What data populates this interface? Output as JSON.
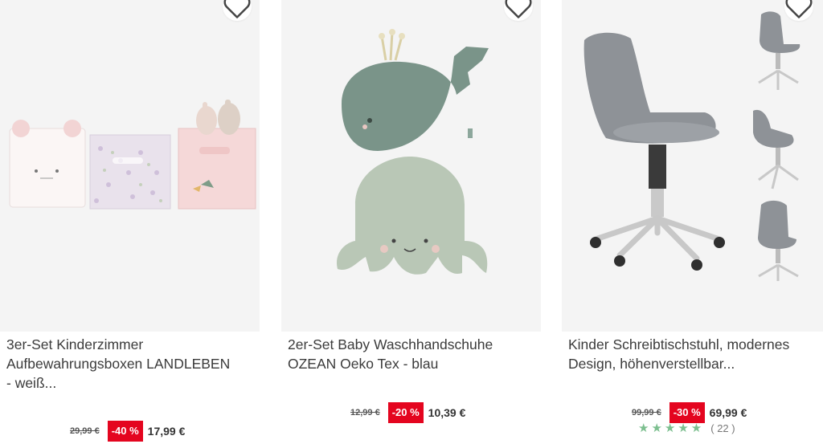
{
  "products": [
    {
      "title": "3er-Set Kinderzimmer\nAufbewahrungsboxen LANDLEBEN\n- weiß...",
      "old_price": "29,99 €",
      "discount": "-40 %",
      "price": "17,99 €"
    },
    {
      "title": "2er-Set Baby Waschhandschuhe\nOZEAN Oeko Tex - blau",
      "old_price": "12,99 €",
      "discount": "-20 %",
      "price": "10,39 €"
    },
    {
      "title": "Kinder Schreibtischstuhl, modernes\nDesign, höhenverstellbar...",
      "old_price": "99,99 €",
      "discount": "-30 %",
      "price": "69,99 €",
      "stars": "★★★★★",
      "review_count": "( 22 )",
      "rating": 5
    }
  ],
  "icons": {
    "favorite": "heart-icon",
    "rating": "star-icon"
  },
  "colors": {
    "discount_badge": "#e4051f",
    "star": "#7cbf8f",
    "image_bg": "#f4f4f4"
  }
}
